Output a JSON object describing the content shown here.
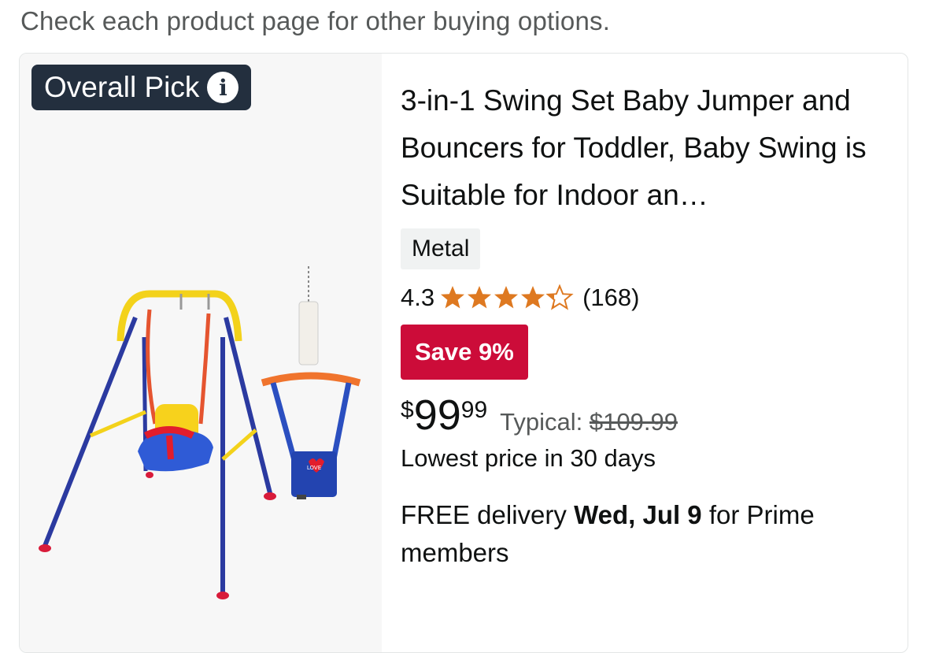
{
  "notice": "Check each product page for other buying options.",
  "badge": {
    "label": "Overall Pick",
    "icon": "info-icon"
  },
  "product": {
    "title": "3-in-1 Swing Set Baby Jumper and Bouncers for Toddler, Baby Swing is Suitable for Indoor an…",
    "material": "Metal",
    "rating_value": "4.3",
    "rating_stars": 4.3,
    "review_count": "(168)",
    "save_badge": "Save 9%",
    "price": {
      "currency": "$",
      "whole": "99",
      "fraction": "99"
    },
    "typical_label": "Typical:",
    "typical_price": "$109.99",
    "lowest_note": "Lowest price in 30 days",
    "delivery": {
      "prefix": "FREE delivery ",
      "date": "Wed, Jul 9",
      "suffix": " for Prime members"
    },
    "image_alt": "Swing set with toddler bucket seat and baby jumper",
    "image_label": "LOVE"
  },
  "colors": {
    "star": "#de7921",
    "save_badge": "#cc0c39",
    "badge_bg": "#232f3e",
    "muted_text": "#565959"
  }
}
